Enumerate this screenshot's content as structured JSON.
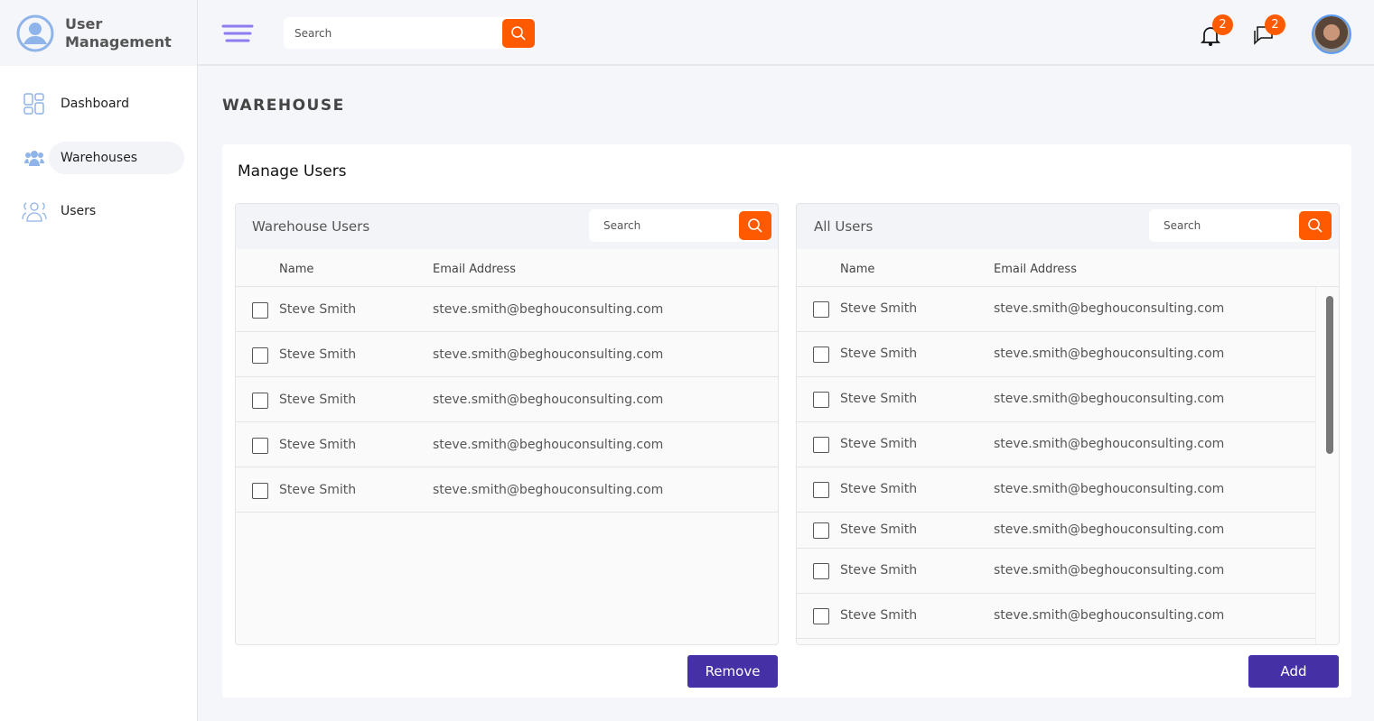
{
  "app": {
    "title_line1": "User",
    "title_line2": "Management"
  },
  "sidebar": {
    "items": [
      {
        "label": "Dashboard"
      },
      {
        "label": "Warehouses"
      },
      {
        "label": "Users"
      }
    ]
  },
  "topbar": {
    "search_placeholder": "Search",
    "notifications_count": "2",
    "messages_count": "2"
  },
  "page": {
    "title": "WAREHOUSE",
    "card_title": "Manage Users"
  },
  "warehouse_users": {
    "title": "Warehouse Users",
    "search_placeholder": "Search",
    "col_name": "Name",
    "col_email": "Email Address",
    "rows": [
      {
        "name": "Steve Smith",
        "email": "steve.smith@beghouconsulting.com"
      },
      {
        "name": "Steve Smith",
        "email": "steve.smith@beghouconsulting.com"
      },
      {
        "name": "Steve Smith",
        "email": "steve.smith@beghouconsulting.com"
      },
      {
        "name": "Steve Smith",
        "email": "steve.smith@beghouconsulting.com"
      },
      {
        "name": "Steve Smith",
        "email": "steve.smith@beghouconsulting.com"
      }
    ],
    "button": "Remove"
  },
  "all_users": {
    "title": "All Users",
    "search_placeholder": "Search",
    "col_name": "Name",
    "col_email": "Email Address",
    "rows": [
      {
        "name": "Steve Smith",
        "email": "steve.smith@beghouconsulting.com"
      },
      {
        "name": "Steve Smith",
        "email": "steve.smith@beghouconsulting.com"
      },
      {
        "name": "Steve Smith",
        "email": "steve.smith@beghouconsulting.com"
      },
      {
        "name": "Steve Smith",
        "email": "steve.smith@beghouconsulting.com"
      },
      {
        "name": "Steve Smith",
        "email": "steve.smith@beghouconsulting.com"
      },
      {
        "name": "Steve Smith",
        "email": "steve.smith@beghouconsulting.com"
      },
      {
        "name": "Steve Smith",
        "email": "steve.smith@beghouconsulting.com"
      },
      {
        "name": "Steve Smith",
        "email": "steve.smith@beghouconsulting.com"
      }
    ],
    "button": "Add"
  },
  "colors": {
    "accent": "#ff5a00",
    "primary": "#4530a6",
    "icon": "#8fb4ea"
  }
}
